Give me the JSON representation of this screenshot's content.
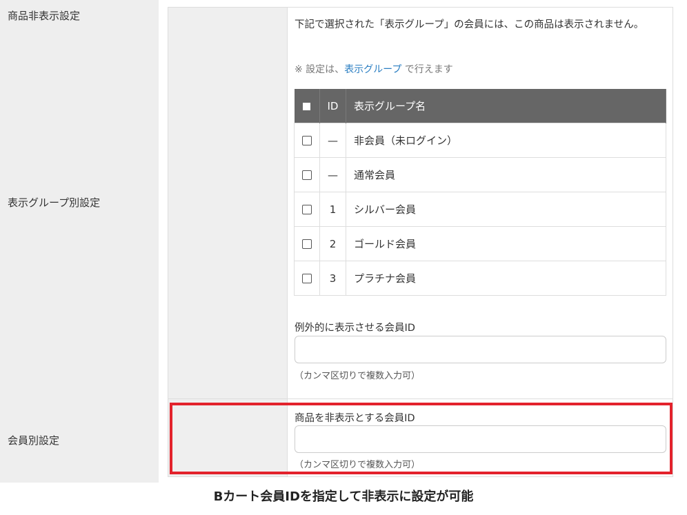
{
  "section_title": "商品非表示設定",
  "group_setting": {
    "label": "表示グループ別設定",
    "description": "下記で選択された「表示グループ」の会員には、この商品は表示されません。",
    "note_prefix": "※ 設定は、",
    "note_link": "表示グループ",
    "note_suffix": " で行えます",
    "table": {
      "headers": {
        "id": "ID",
        "name": "表示グループ名"
      },
      "rows": [
        {
          "id": "—",
          "name": "非会員（未ログイン）"
        },
        {
          "id": "—",
          "name": "通常会員"
        },
        {
          "id": "1",
          "name": "シルバー会員"
        },
        {
          "id": "2",
          "name": "ゴールド会員"
        },
        {
          "id": "3",
          "name": "プラチナ会員"
        }
      ]
    },
    "exception_label": "例外的に表示させる会員ID",
    "exception_value": "",
    "exception_hint": "（カンマ区切りで複数入力可）"
  },
  "member_setting": {
    "label": "会員別設定",
    "field_label": "商品を非表示とする会員ID",
    "field_value": "",
    "hint": "（カンマ区切りで複数入力可）"
  },
  "caption": "Bカート会員IDを指定して非表示に設定が可能",
  "colors": {
    "highlight": "#e3222c",
    "link": "#2a7ec2",
    "table_header": "#666666"
  }
}
